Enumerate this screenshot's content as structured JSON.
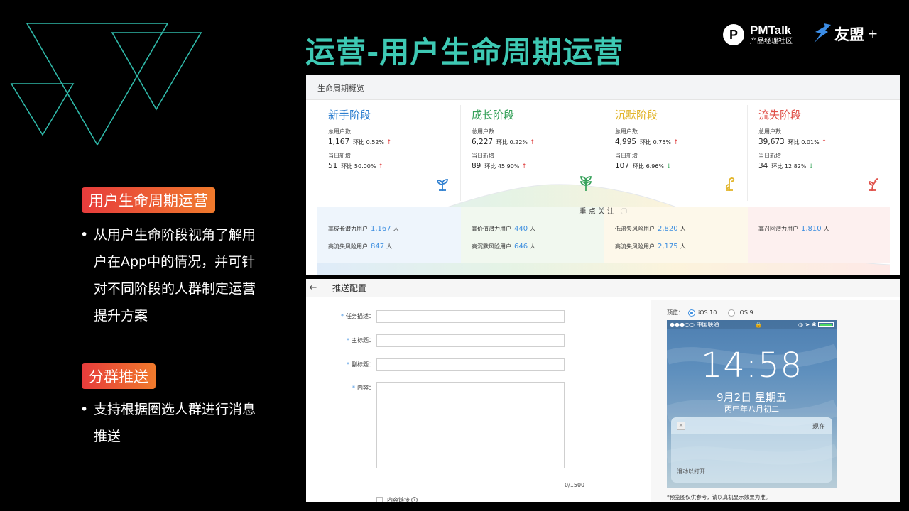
{
  "slide": {
    "title": "运营-用户生命周期运营",
    "logo_pmtalk": {
      "mark": "P",
      "name": "PMTalk",
      "sub": "产品经理社区"
    },
    "logo_umeng": {
      "name": "友盟",
      "plus": "+"
    }
  },
  "left": {
    "section1_badge": "用户生命周期运营",
    "section1_bullet": "从用户生命阶段视角了解用户在App中的情况，并可针对不同阶段的人群制定运营提升方案",
    "section2_badge": "分群推送",
    "section2_bullet": "支持根据圈选人群进行消息推送",
    "bullet_dot": "•"
  },
  "lifecycle": {
    "header": "生命周期概览",
    "stages": [
      {
        "name": "新手阶段",
        "color": "#2e7fd0",
        "total_label": "总用户数",
        "total": "1,167",
        "total_cmp": "环比 0.52%",
        "total_dir": "up",
        "new_label": "当日新增",
        "new": "51",
        "new_cmp": "环比 50.00%",
        "new_dir": "up",
        "icon": "sprout-icon"
      },
      {
        "name": "成长阶段",
        "color": "#36a15a",
        "total_label": "总用户数",
        "total": "6,227",
        "total_cmp": "环比 0.22%",
        "total_dir": "up",
        "new_label": "当日新增",
        "new": "89",
        "new_cmp": "环比 45.90%",
        "new_dir": "up",
        "icon": "plant-icon"
      },
      {
        "name": "沉默阶段",
        "color": "#e2b52a",
        "total_label": "总用户数",
        "total": "4,995",
        "total_cmp": "环比 0.75%",
        "total_dir": "up",
        "new_label": "当日新增",
        "new": "107",
        "new_cmp": "环比 6.96%",
        "new_dir": "down",
        "icon": "drooping-plant-icon"
      },
      {
        "name": "流失阶段",
        "color": "#e0514a",
        "total_label": "总用户数",
        "total": "39,673",
        "total_cmp": "环比 0.01%",
        "total_dir": "up",
        "new_label": "当日新增",
        "new": "34",
        "new_cmp": "环比 12.82%",
        "new_dir": "down",
        "icon": "wilted-plant-icon"
      }
    ],
    "arrow_up": "↑",
    "arrow_down": "↓",
    "focus_title": "重点关注",
    "focus_info": "ⓘ",
    "focus": [
      {
        "label": "高成长潜力用户",
        "value": "1,167",
        "unit": "人"
      },
      {
        "label": "高流失风险用户",
        "value": "847",
        "unit": "人"
      },
      {
        "label": "高价值潜力用户",
        "value": "440",
        "unit": "人"
      },
      {
        "label": "高沉默风险用户",
        "value": "646",
        "unit": "人"
      },
      {
        "label": "低流失风险用户",
        "value": "2,820",
        "unit": "人"
      },
      {
        "label": "高流失风险用户",
        "value": "2,175",
        "unit": "人"
      },
      {
        "label": "高召回潜力用户",
        "value": "1,810",
        "unit": "人"
      }
    ]
  },
  "push": {
    "back": "←",
    "title": "推送配置",
    "required_mark": "*",
    "fields": {
      "task": "任务描述：",
      "main_title": "主标题：",
      "sub_title": "副标题：",
      "content": "内容："
    },
    "counter": "0/1500",
    "link_checkbox": "内容链接",
    "link_help": "?",
    "preview_label": "预览：",
    "ios10": "iOS 10",
    "ios9": "iOS 9",
    "phone": {
      "carrier": "●●●○○ 中国联通",
      "status_right": "◎ ➤ ✱",
      "time": "14:58",
      "date": "9月2日 星期五",
      "lunar": "丙申年八月初二",
      "notif_icon": "✕",
      "notif_now": "现在",
      "slide_open": "滑动以打开"
    },
    "note": "*预览图仅供参考，请以真机显示效果为准。"
  }
}
